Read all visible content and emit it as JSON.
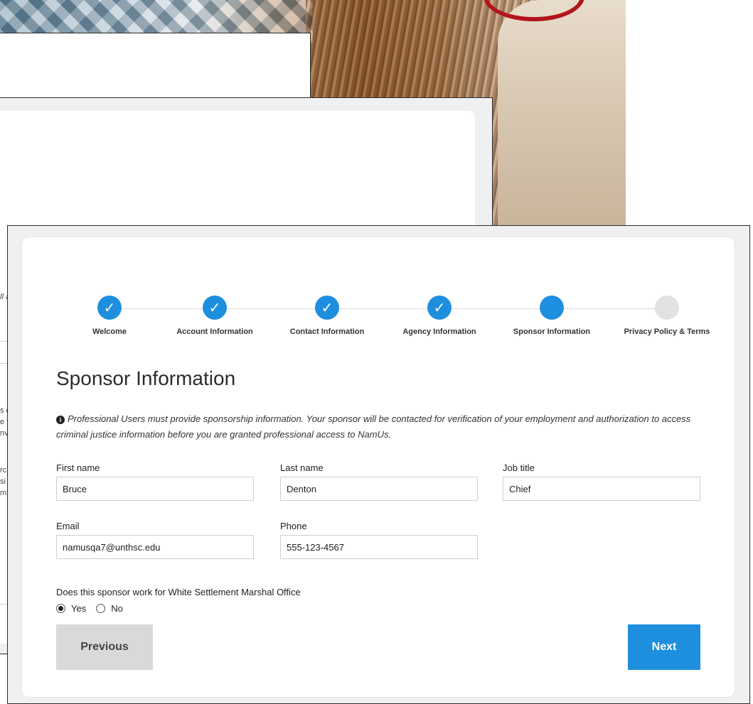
{
  "colors": {
    "accent": "#1e8fde",
    "step_todo": "#e2e2e2",
    "button_secondary": "#d9d9d9",
    "card_background": "#ffffff",
    "window_background": "#eef0f2",
    "photo_red_mark": "#b3151b"
  },
  "background_fragments": {
    "win2_lines": [
      "ll a",
      "s c",
      "e f",
      "nv",
      "rc",
      "si",
      "m"
    ]
  },
  "stepper": {
    "current_step": 5,
    "steps": [
      {
        "label": "Welcome",
        "state": "done",
        "icon": "checkmark-icon"
      },
      {
        "label": "Account Information",
        "state": "done",
        "icon": "checkmark-icon"
      },
      {
        "label": "Contact Information",
        "state": "done",
        "icon": "checkmark-icon"
      },
      {
        "label": "Agency Information",
        "state": "done",
        "icon": "checkmark-icon"
      },
      {
        "label": "Sponsor Information",
        "state": "active",
        "icon": "current-step-dot"
      },
      {
        "label": "Privacy Policy & Terms",
        "state": "todo",
        "icon": "pending-step-dot"
      }
    ]
  },
  "page": {
    "title": "Sponsor Information",
    "notice_icon": "info-circle-icon",
    "notice": "Professional Users must provide sponsorship information. Your sponsor will be contacted for verification of your employment and authorization to access criminal justice information before you are granted professional access to NamUs."
  },
  "form": {
    "first_name": {
      "label": "First name",
      "value": "Bruce"
    },
    "last_name": {
      "label": "Last name",
      "value": "Denton"
    },
    "job_title": {
      "label": "Job title",
      "value": "Chief"
    },
    "email": {
      "label": "Email",
      "value": "namusqa7@unthsc.edu"
    },
    "phone": {
      "label": "Phone",
      "value": "555-123-4567"
    },
    "question": "Does this sponsor work for White Settlement Marshal Office",
    "options": {
      "yes": "Yes",
      "no": "No"
    },
    "selected": "Yes"
  },
  "buttons": {
    "previous": "Previous",
    "next": "Next"
  }
}
